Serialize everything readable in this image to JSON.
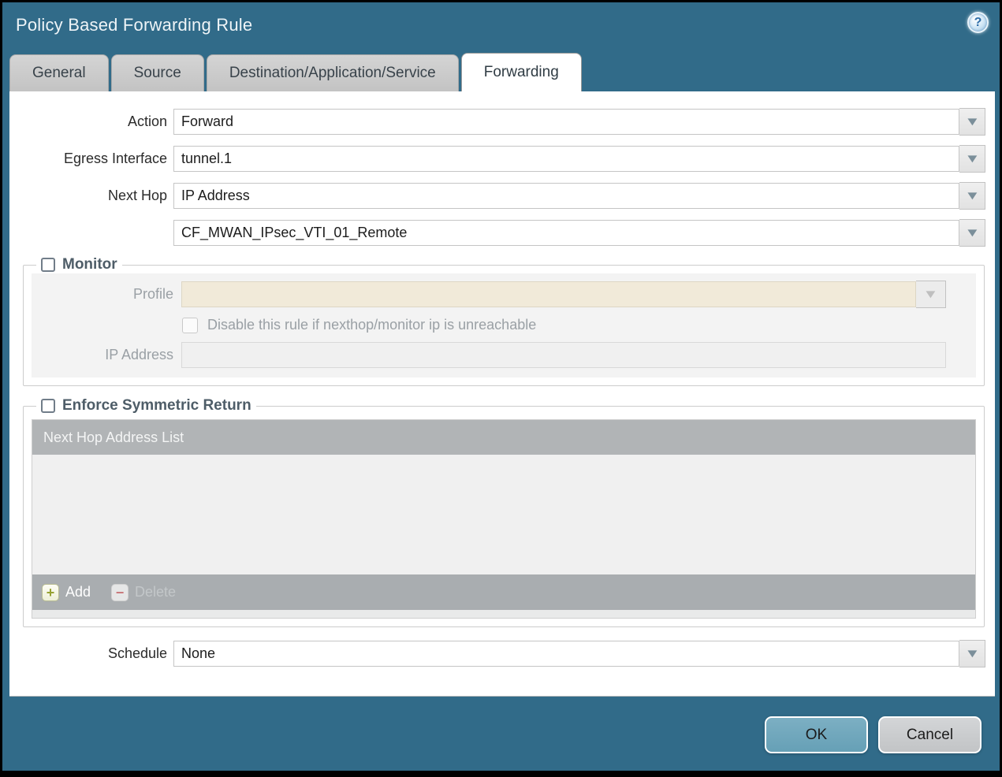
{
  "dialog": {
    "title": "Policy Based Forwarding Rule"
  },
  "icons": {
    "help": "?",
    "dropdown": "▼",
    "add": "+",
    "delete": "−"
  },
  "tabs": [
    {
      "label": "General",
      "active": false
    },
    {
      "label": "Source",
      "active": false
    },
    {
      "label": "Destination/Application/Service",
      "active": false
    },
    {
      "label": "Forwarding",
      "active": true
    }
  ],
  "form": {
    "action": {
      "label": "Action",
      "value": "Forward"
    },
    "egress_interface": {
      "label": "Egress Interface",
      "value": "tunnel.1"
    },
    "next_hop": {
      "label": "Next Hop",
      "value": "IP Address"
    },
    "next_hop_address": {
      "value": "CF_MWAN_IPsec_VTI_01_Remote"
    },
    "schedule": {
      "label": "Schedule",
      "value": "None"
    }
  },
  "monitor": {
    "title": "Monitor",
    "checked": false,
    "profile": {
      "label": "Profile",
      "value": ""
    },
    "disable_rule": {
      "label": "Disable this rule if nexthop/monitor ip is unreachable",
      "checked": false
    },
    "ip_address": {
      "label": "IP Address",
      "value": ""
    }
  },
  "enforce_symmetric_return": {
    "title": "Enforce Symmetric Return",
    "checked": false,
    "table": {
      "header": "Next Hop Address List",
      "rows": []
    },
    "buttons": {
      "add": "Add",
      "delete": "Delete"
    }
  },
  "footer": {
    "ok": "OK",
    "cancel": "Cancel"
  },
  "colors": {
    "frame_teal": "#316b89",
    "ok_button": "#6fa8be",
    "cancel_button": "#c9cbce",
    "disabled_field_beige": "#f1ead9",
    "table_header_gray": "#b1b4b6",
    "table_footer_gray": "#a9adb0",
    "section_title": "#4e5d68",
    "tab_inactive": "#c8c8c8"
  }
}
